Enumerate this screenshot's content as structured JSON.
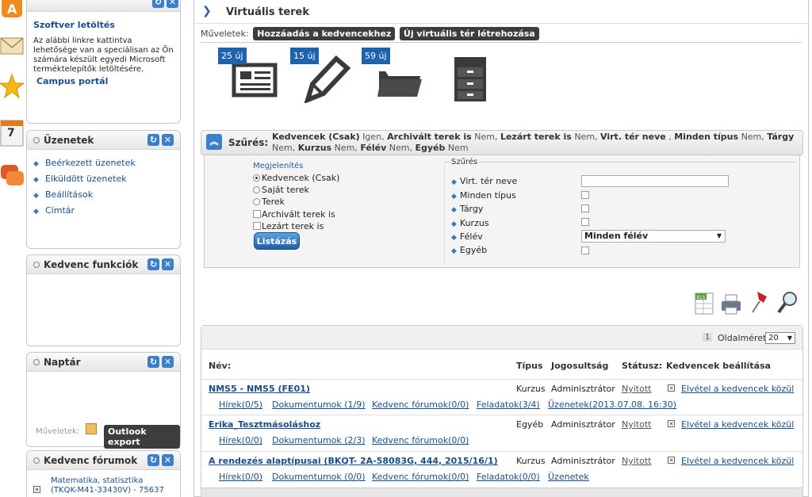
{
  "left_strip": {
    "calendar_day": "7"
  },
  "panels": {
    "download": {
      "title": "Szoftver letöltés",
      "text": "Az alábbi linkre kattintva lehetősége van a speciálisan az Ön számára készült egyedi Microsoft terméktelepítők letöltésére.",
      "link": "Campus portál"
    },
    "messages": {
      "title": "Üzenetek",
      "items": [
        "Beérkezett üzenetek",
        "Elküldött üzenetek",
        "Beállítások",
        "Címtár"
      ]
    },
    "favorites": {
      "title": "Kedvenc funkciók"
    },
    "calendar": {
      "title": "Naptár",
      "ops_label": "Műveletek:",
      "export_button": "Outlook export"
    },
    "forums": {
      "title": "Kedvenc fórumok",
      "item1_line1": "Matematika, statisztika",
      "item1_line2": "(TKQK-M41-33430V) - 75637"
    }
  },
  "main": {
    "title": "Virtuális terek",
    "ops_label": "Műveletek:",
    "add_fav_button": "Hozzáadás a kedvencekhez",
    "new_space_button": "Új virtuális tér létrehozása",
    "icons": [
      {
        "badge": "25 új",
        "name": "news-icon"
      },
      {
        "badge": "15 új",
        "name": "pencil-icon"
      },
      {
        "badge": "59 új",
        "name": "folder-icon"
      },
      {
        "badge": "",
        "name": "cabinet-icon"
      }
    ],
    "filter": {
      "label": "Szűrés:",
      "summary_parts": [
        {
          "k": "Kedvencek (Csak)",
          "v": "Igen"
        },
        {
          "k": "Archivált terek is",
          "v": "Nem"
        },
        {
          "k": "Lezárt terek is",
          "v": "Nem"
        },
        {
          "k": "Virt. tér neve",
          "v": ""
        },
        {
          "k": "Minden típus",
          "v": "Nem"
        },
        {
          "k": "Tárgy",
          "v": "Nem"
        },
        {
          "k": "Kurzus",
          "v": "Nem"
        },
        {
          "k": "Félév",
          "v": "Nem"
        },
        {
          "k": "Egyéb",
          "v": "Nem"
        }
      ],
      "display_legend": "Megjelenítés",
      "radio1": "Kedvencek (Csak)",
      "radio2": "Saját terek",
      "radio3": "Terek",
      "check1": "Archivált terek is",
      "check2": "Lezárt terek is",
      "list_button": "Listázás",
      "filter_legend": "Szűrés",
      "rows": [
        "Virt. tér neve",
        "Minden típus",
        "Tárgy",
        "Kurzus",
        "Félév",
        "Egyéb"
      ],
      "semester_value": "Minden félév"
    },
    "results": {
      "page_number": "1",
      "page_size_label": "Oldalméret",
      "page_size_value": "20",
      "headers": {
        "name": "Név:",
        "type": "Típus",
        "rights": "Jogosultság",
        "status": "Státusz:",
        "fav": "Kedvencek beállítása"
      },
      "rows": [
        {
          "name": "NMS5 - NMS5 (FE01)",
          "type": "Kurzus",
          "rights": "Adminisztrátor",
          "status": "Nyitott",
          "fav": "Elvétel a kedvencek közül",
          "sub": [
            "Hírek(0/5)",
            "Dokumentumok (1/9)",
            "Kedvenc fórumok(0/0)",
            "Feladatok(3/4)",
            "Üzenetek(2013.07.08. 16:30)"
          ]
        },
        {
          "name": "Erika_Tesztmásoláshoz",
          "type": "Egyéb",
          "rights": "Adminisztrátor",
          "status": "Nyitott",
          "fav": "Elvétel a kedvencek közül",
          "sub": [
            "Hírek(0/0)",
            "Dokumentumok (2/3)",
            "Kedvenc fórumok(0/0)"
          ]
        },
        {
          "name": "A rendezés alaptípusai (BKQT- 2A-58083G, 444, 2015/16/1)",
          "type": "Kurzus",
          "rights": "Adminisztrátor",
          "status": "Nyitott",
          "fav": "Elvétel a kedvencek közül",
          "sub": [
            "Hírek(0/0)",
            "Dokumentumok (0/0)",
            "Kedvenc fórumok(0/0)",
            "Feladatok(0/0)",
            "Üzenetek"
          ]
        }
      ]
    }
  }
}
